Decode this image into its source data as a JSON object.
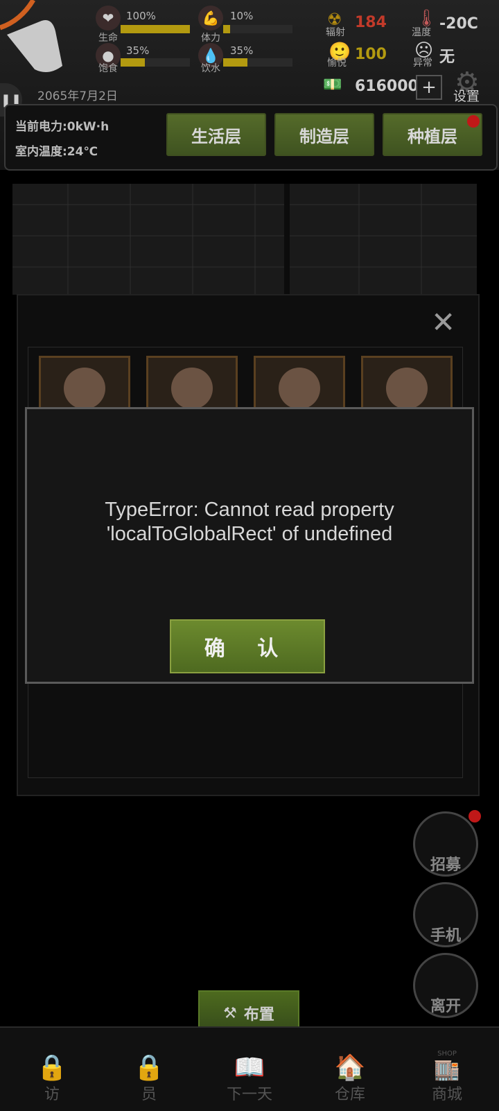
{
  "hud": {
    "stats": [
      {
        "label": "生命",
        "pct": "100%",
        "fill": 1.0,
        "icon": "heart-icon"
      },
      {
        "label": "体力",
        "pct": "10%",
        "fill": 0.1,
        "icon": "muscle-icon"
      },
      {
        "label": "饱食",
        "pct": "35%",
        "fill": 0.35,
        "icon": "stomach-icon"
      },
      {
        "label": "饮水",
        "pct": "35%",
        "fill": 0.35,
        "icon": "water-drop-icon"
      }
    ],
    "radiation": {
      "label": "辐射",
      "value": "184"
    },
    "temperature": {
      "label": "温度",
      "value": "-20C"
    },
    "mood": {
      "label": "愉悦",
      "value": "100"
    },
    "abnormal": {
      "label": "异常",
      "value": "无"
    },
    "money": {
      "value": "616000",
      "plus": "+"
    },
    "settings_label": "设置",
    "date": "2065年7月2日",
    "power": "当前电力:0kW·h",
    "indoor_temp": "室内温度:24℃",
    "layers": [
      "生活层",
      "制造层",
      "种植层"
    ]
  },
  "dialog": {
    "message": "TypeError: Cannot read property 'localToGlobalRect' of undefined",
    "confirm_label": "确 认"
  },
  "side": {
    "recruit": "招募",
    "phone": "手机",
    "leave": "离开"
  },
  "arrange_label": "布置",
  "nav": {
    "items": [
      "访",
      "员",
      "下一天",
      "仓库",
      "商城"
    ],
    "shop_badge": "SHOP"
  },
  "colors": {
    "accent_green": "#556b2a",
    "gold_text": "#b39a10",
    "radiation_red": "#c23a2a"
  }
}
